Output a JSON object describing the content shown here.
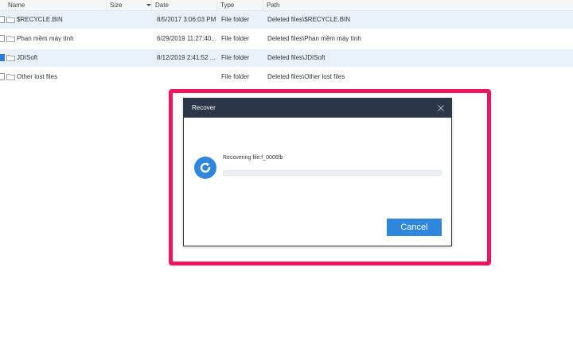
{
  "columns": {
    "name": "Name",
    "size": "Size",
    "date": "Date",
    "type": "Type",
    "path": "Path"
  },
  "rows": [
    {
      "name": "$RECYCLE.BIN",
      "date": "8/5/2017 3:06:03 PM",
      "type": "File folder",
      "path": "Deleted files\\$RECYCLE.BIN",
      "checked": false,
      "selected": true
    },
    {
      "name": "Phan mềm máy tính",
      "date": "6/29/2019 11:27:40...",
      "type": "File folder",
      "path": "Deleted files\\Phan mềm máy tính",
      "checked": false,
      "selected": false
    },
    {
      "name": "JDISoft",
      "date": "8/12/2019 2:41:52 ...",
      "type": "File folder",
      "path": "Deleted files\\JDISoft",
      "checked": true,
      "selected": true
    },
    {
      "name": "Other lost files",
      "date": "",
      "type": "File folder",
      "path": "Deleted files\\Other lost files",
      "checked": false,
      "selected": false
    }
  ],
  "dialog": {
    "title": "Recover",
    "status": "Recovering file:f_0006fb",
    "progress": 0,
    "cancel_label": "Cancel",
    "spinner_icon": "refresh-icon",
    "close_icon": "close-icon"
  },
  "colors": {
    "highlight": "#f0145c",
    "accent": "#2f86dd",
    "titlebar": "#2b3649"
  }
}
